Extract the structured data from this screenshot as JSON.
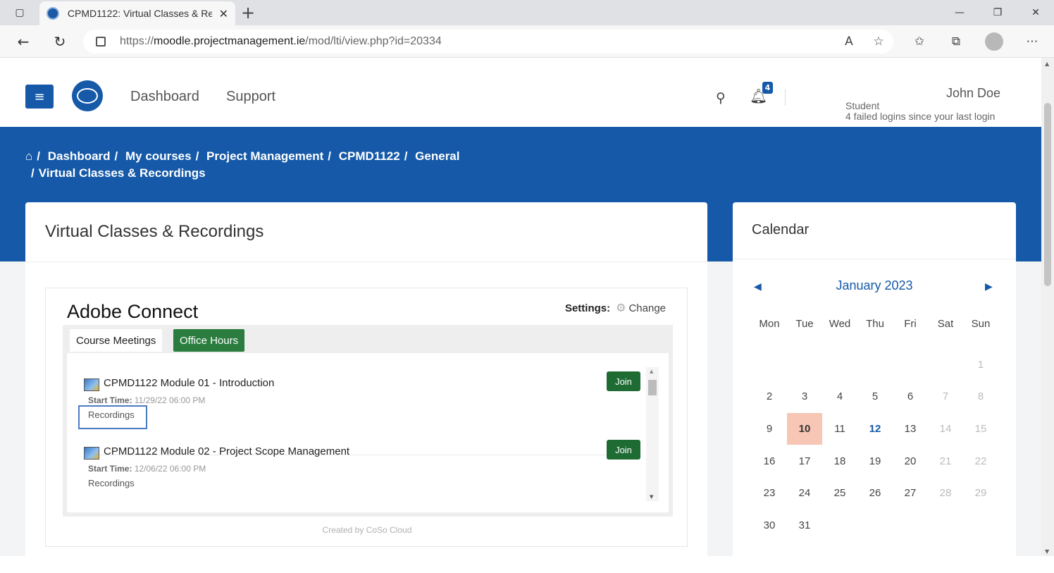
{
  "browser": {
    "tab_title": "CPMD1122: Virtual Classes & Re",
    "url_prefix": "https://",
    "url_domain": "moodle.projectmanagement.ie",
    "url_path": "/mod/lti/view.php?id=20334"
  },
  "header": {
    "nav": [
      "Dashboard",
      "Support"
    ],
    "notification_count": "4",
    "user_name": "John Doe",
    "user_role": "Student",
    "user_logins": "4 failed logins since your last login"
  },
  "breadcrumb": [
    "Dashboard",
    "My courses",
    "Project Management",
    "CPMD1122",
    "General",
    "Virtual Classes & Recordings"
  ],
  "main": {
    "title": "Virtual Classes & Recordings",
    "adobe": {
      "title": "Adobe Connect",
      "settings_label": "Settings:",
      "settings_action": "Change",
      "tabs": [
        "Course Meetings",
        "Office Hours"
      ],
      "meetings": [
        {
          "title": "CPMD1122 Module 01 - Introduction",
          "start_label": "Start Time:",
          "start_value": "11/29/22 06:00 PM",
          "recordings": "Recordings",
          "join": "Join"
        },
        {
          "title": "CPMD1122 Module 02 - Project Scope Management",
          "start_label": "Start Time:",
          "start_value": "12/06/22 06:00 PM",
          "recordings": "Recordings",
          "join": "Join"
        }
      ],
      "footer": "Created by  CoSo Cloud"
    }
  },
  "calendar": {
    "title": "Calendar",
    "month": "January 2023",
    "weekdays": [
      "Mon",
      "Tue",
      "Wed",
      "Thu",
      "Fri",
      "Sat",
      "Sun"
    ],
    "days": [
      "",
      "",
      "",
      "",
      "",
      "",
      "1",
      "2",
      "3",
      "4",
      "5",
      "6",
      "7",
      "8",
      "9",
      "10",
      "11",
      "12",
      "13",
      "14",
      "15",
      "16",
      "17",
      "18",
      "19",
      "20",
      "21",
      "22",
      "23",
      "24",
      "25",
      "26",
      "27",
      "28",
      "29",
      "30",
      "31"
    ],
    "today": "10",
    "event_days": [
      "12"
    ]
  }
}
